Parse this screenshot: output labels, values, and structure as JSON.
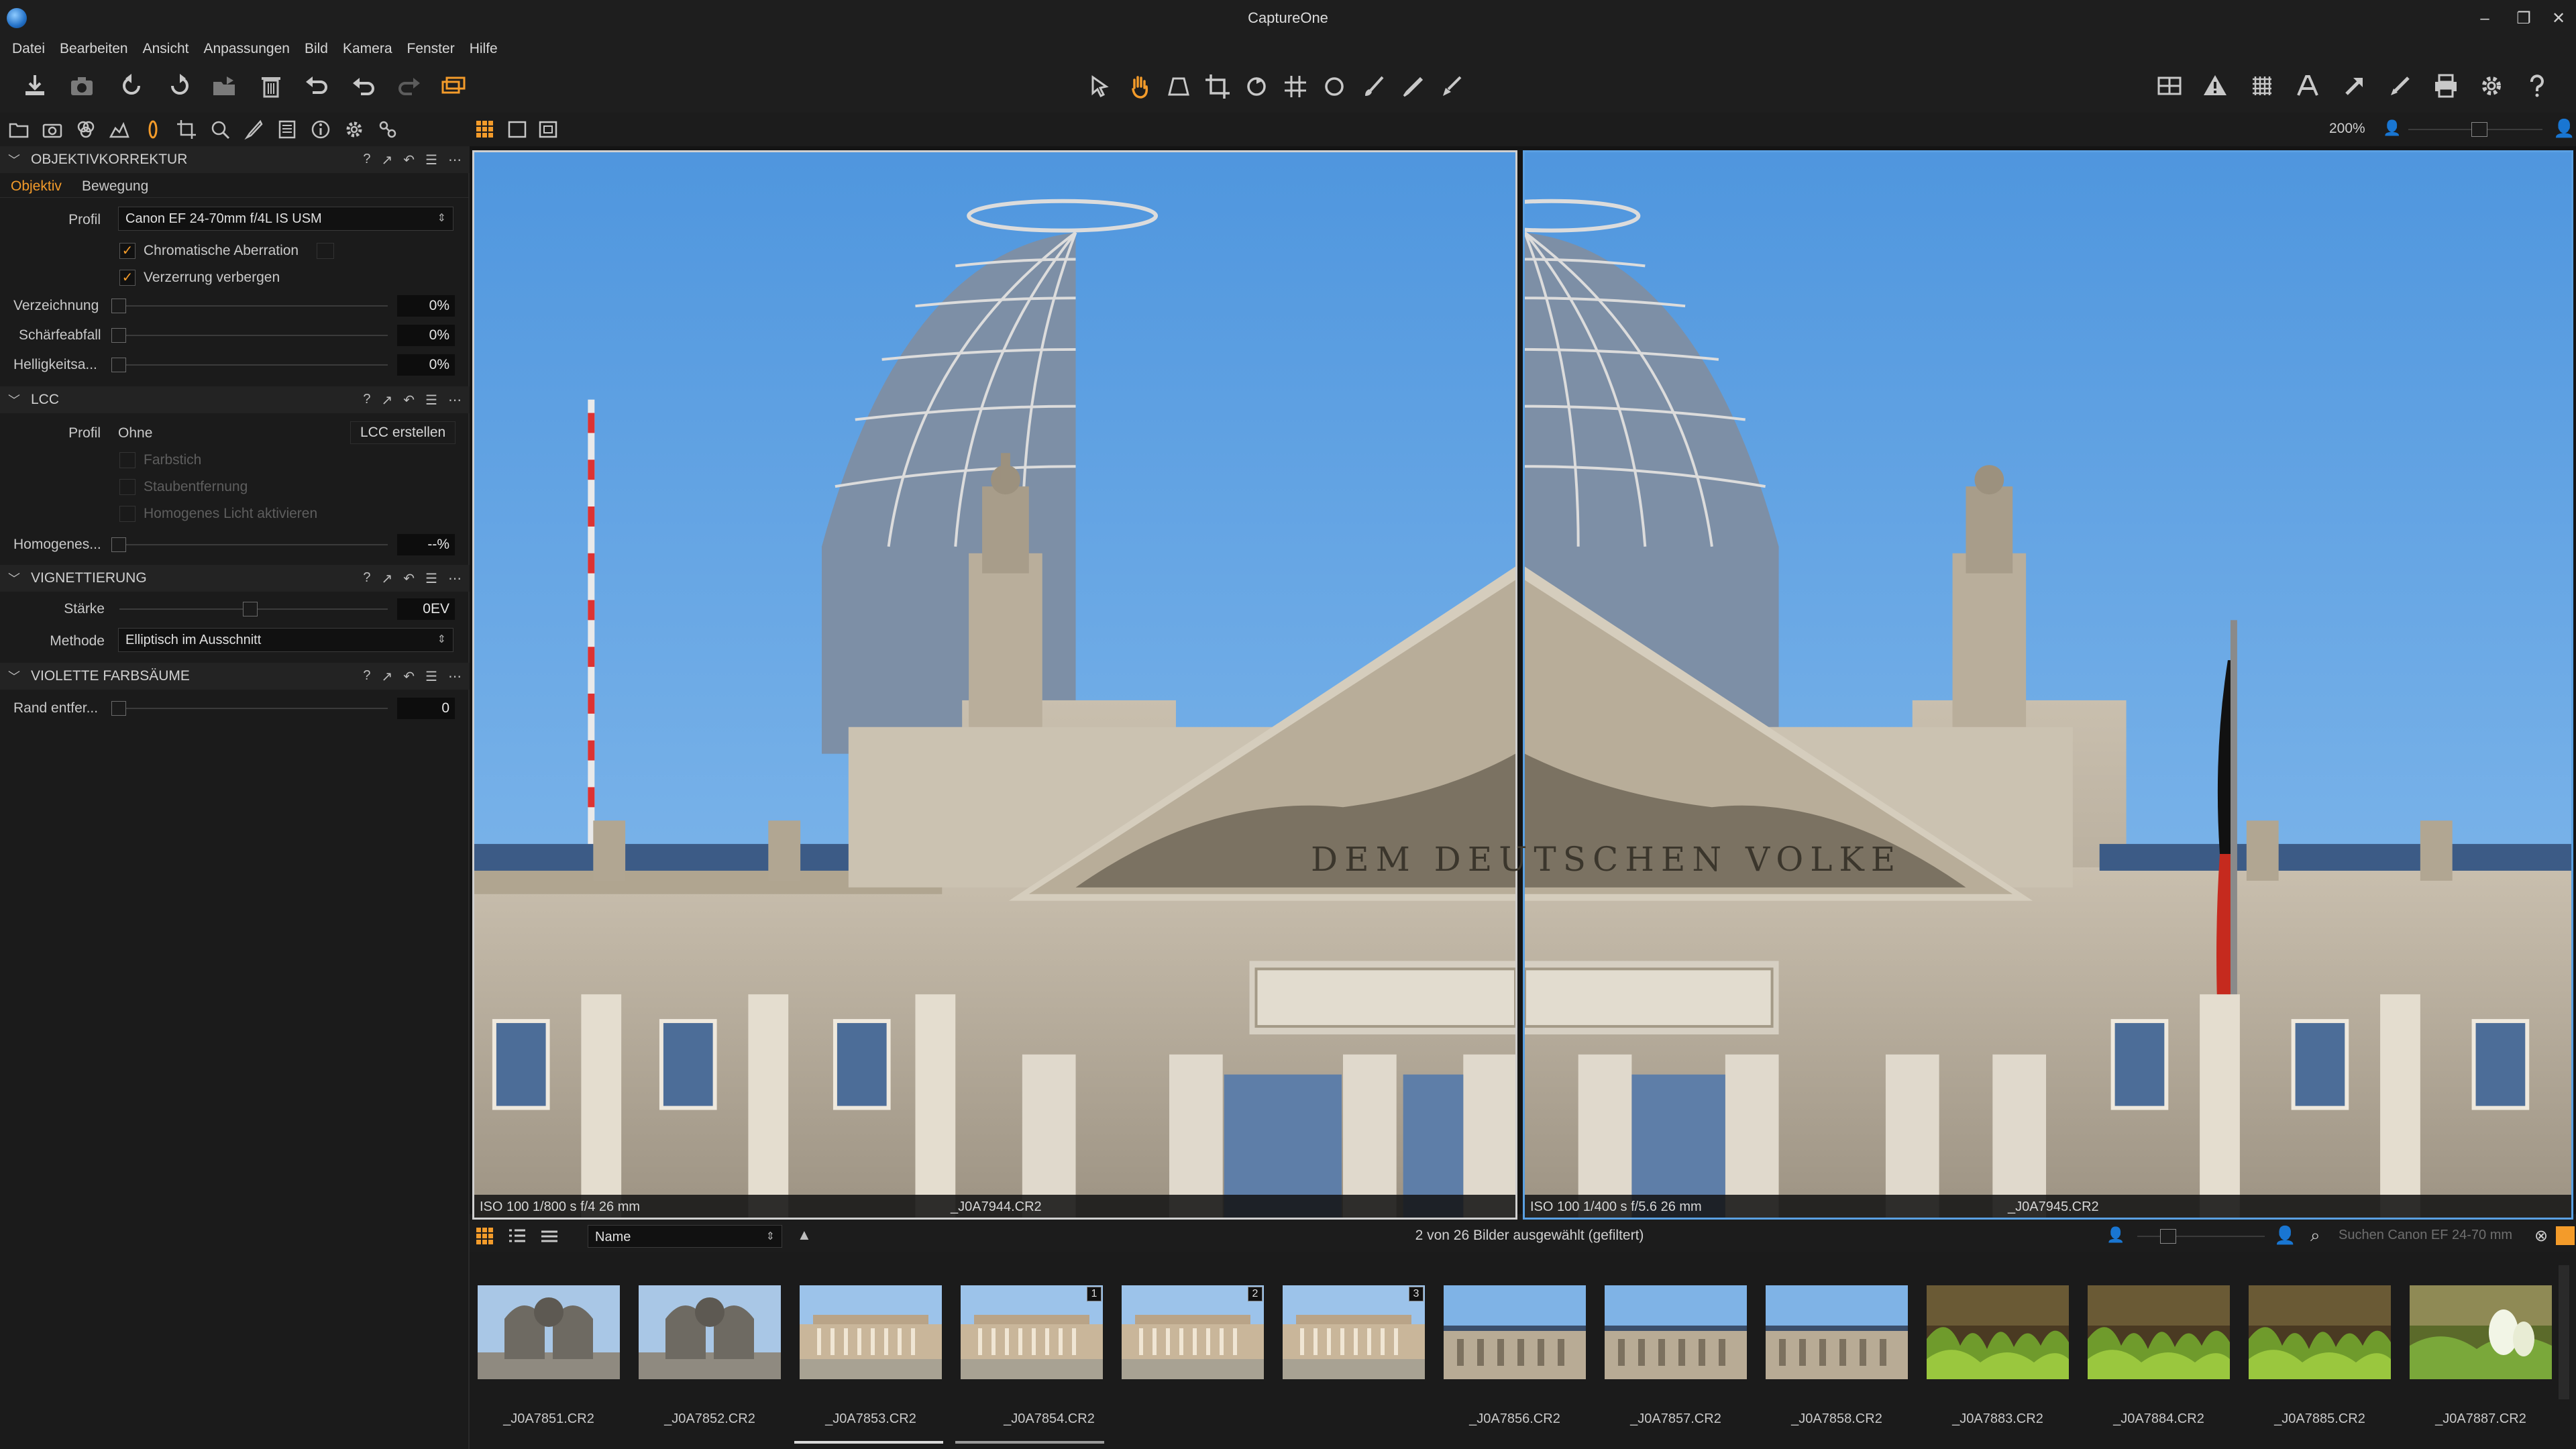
{
  "window": {
    "title": "CaptureOne",
    "minimize": "–",
    "maximize": "❐",
    "close": "✕"
  },
  "menu": [
    "Datei",
    "Bearbeiten",
    "Ansicht",
    "Anpassungen",
    "Bild",
    "Kamera",
    "Fenster",
    "Hilfe"
  ],
  "toolbar": {
    "left_icons": [
      "import-icon",
      "camera-icon",
      "rotate-left-icon",
      "rotate-right-icon",
      "export-folder-icon",
      "trash-icon",
      "undo-history-icon",
      "undo-icon",
      "redo-icon",
      "process-icon"
    ],
    "center_icons": [
      "select-cursor-icon",
      "hand-pan-icon",
      "keystone-icon",
      "crop-icon",
      "rotate-tool-icon",
      "grid-tool-icon",
      "circle-mask-icon",
      "brush-icon",
      "picker-icon",
      "eraser-icon"
    ],
    "right_icons": [
      "viewer-layout-icon",
      "exposure-warning-icon",
      "grid-overlay-icon",
      "text-overlay-icon",
      "copy-adjustments-icon",
      "apply-adjustments-icon",
      "print-icon",
      "settings-icon",
      "help-icon"
    ]
  },
  "tool_tabs": [
    "library-icon",
    "capture-icon",
    "color-icon",
    "exposure-icon",
    "lens-icon",
    "crop-tab-icon",
    "focus-icon",
    "adjust-icon",
    "metadata-icon",
    "info-icon",
    "settings-tab-icon",
    "batch-icon"
  ],
  "viewer_topbar": {
    "zoom": "200%"
  },
  "panel": {
    "objektivkorrektur": {
      "title": "OBJEKTIVKORREKTUR",
      "tabs": [
        "Objektiv",
        "Bewegung"
      ],
      "active_tab": "Objektiv",
      "profil_label": "Profil",
      "profil_value": "Canon EF 24-70mm f/4L IS USM",
      "chk_chromatic": "Chromatische Aberration",
      "chk_distortion": "Verzerrung verbergen",
      "sliders": [
        {
          "label": "Verzeichnung",
          "value": "0%"
        },
        {
          "label": "Schärfeabfall",
          "value": "0%"
        },
        {
          "label": "Helligkeitsa...",
          "value": "0%"
        }
      ]
    },
    "lcc": {
      "title": "LCC",
      "profil_label": "Profil",
      "profil_value": "Ohne",
      "create_button": "LCC erstellen",
      "chk_farbstich": "Farbstich",
      "chk_staub": "Staubentfernung",
      "chk_licht": "Homogenes Licht aktivieren",
      "homogen_label": "Homogenes...",
      "homogen_value": "--%"
    },
    "vignettierung": {
      "title": "VIGNETTIERUNG",
      "staerke_label": "Stärke",
      "staerke_value": "0EV",
      "methode_label": "Methode",
      "methode_value": "Elliptisch im Ausschnitt"
    },
    "violette": {
      "title": "VIOLETTE FARBSÄUME",
      "rand_label": "Rand entfer...",
      "rand_value": "0"
    }
  },
  "viewer": {
    "left": {
      "meta": "ISO 100  1/800 s  f/4  26 mm",
      "name": "_J0A7944.CR2"
    },
    "right": {
      "meta": "ISO 100  1/400 s  f/5.6  26 mm",
      "name": "_J0A7945.CR2"
    },
    "inscription": "DEM DEUTSCHEN VOLKE"
  },
  "browser": {
    "sort_label": "Name",
    "status": "2 von 26 Bilder ausgewählt (gefiltert)",
    "search_placeholder": "Suchen Canon EF 24-70 mm",
    "thumbnails": [
      {
        "name": "_J0A7851.CR2",
        "scene": "cathedral"
      },
      {
        "name": "_J0A7852.CR2",
        "scene": "cathedral"
      },
      {
        "name": "_J0A7853.CR2",
        "scene": "museum"
      },
      {
        "name": "_J0A7854.CR2",
        "scene": "museum",
        "badge": "1"
      },
      {
        "name": "",
        "scene": "museum",
        "badge": "2"
      },
      {
        "name": "",
        "scene": "museum",
        "badge": "3"
      },
      {
        "name": "_J0A7856.CR2",
        "scene": "reichstag"
      },
      {
        "name": "_J0A7857.CR2",
        "scene": "reichstag"
      },
      {
        "name": "_J0A7858.CR2",
        "scene": "reichstag"
      },
      {
        "name": "_J0A7883.CR2",
        "scene": "grass"
      },
      {
        "name": "_J0A7884.CR2",
        "scene": "grass"
      },
      {
        "name": "_J0A7885.CR2",
        "scene": "grass"
      },
      {
        "name": "_J0A7887.CR2",
        "scene": "flowers"
      }
    ]
  },
  "colors": {
    "accent": "#f39b2a",
    "background": "#1b1b1b",
    "sky": "#5aa0e2"
  }
}
